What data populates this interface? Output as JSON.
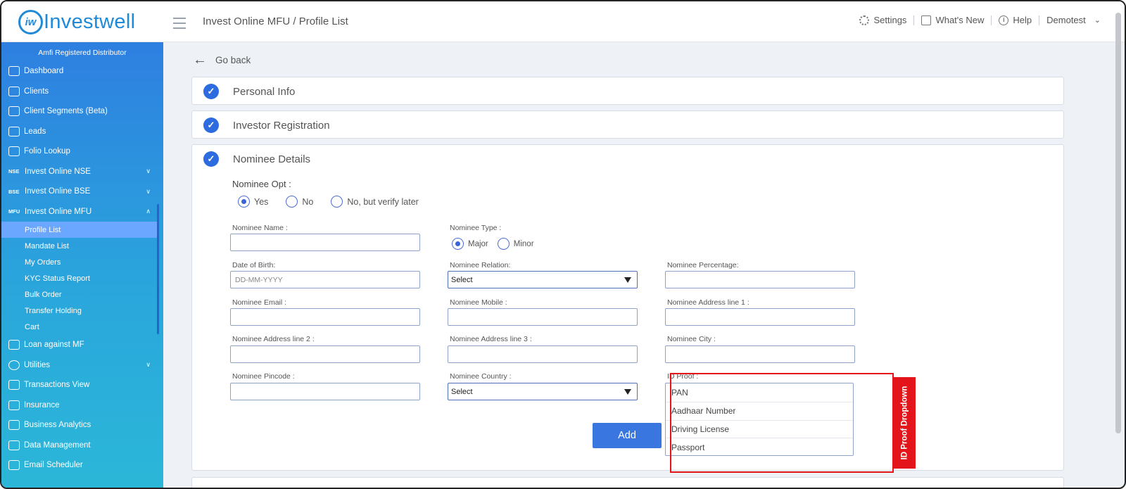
{
  "app": {
    "logo_mark": "iw",
    "logo_text": "Investwell",
    "breadcrumb": "Invest Online MFU / Profile List"
  },
  "topnav": {
    "settings": "Settings",
    "whats_new": "What's New",
    "help": "Help",
    "user": "Demotest"
  },
  "sidebar": {
    "title": "Amfi Registered Distributor",
    "items": [
      {
        "label": "Dashboard"
      },
      {
        "label": "Clients"
      },
      {
        "label": "Client Segments (Beta)"
      },
      {
        "label": "Leads"
      },
      {
        "label": "Folio Lookup"
      },
      {
        "tag": "NSE",
        "label": "Invest Online NSE",
        "caret": "v"
      },
      {
        "tag": "BSE",
        "label": "Invest Online BSE",
        "caret": "v"
      },
      {
        "tag": "MFU",
        "label": "Invest Online MFU",
        "caret": "^"
      }
    ],
    "sub_items": [
      "Profile List",
      "Mandate List",
      "My Orders",
      "KYC Status Report",
      "Bulk Order",
      "Transfer Holding",
      "Cart"
    ],
    "items_bottom": [
      {
        "label": "Loan against MF"
      },
      {
        "label": "Utilities",
        "caret": "v"
      },
      {
        "label": "Transactions View"
      },
      {
        "label": "Insurance"
      },
      {
        "label": "Business Analytics"
      },
      {
        "label": "Data Management"
      },
      {
        "label": "Email Scheduler"
      }
    ]
  },
  "main": {
    "go_back": "Go back",
    "sections": {
      "personal": "Personal Info",
      "registration": "Investor Registration",
      "nominee": "Nominee Details"
    },
    "nominee_opt": {
      "label": "Nominee Opt :",
      "options": [
        "Yes",
        "No",
        "No, but verify later"
      ],
      "selected": "Yes"
    },
    "nominee_type": {
      "label": "Nominee Type :",
      "options": [
        "Major",
        "Minor"
      ],
      "selected": "Major"
    },
    "fields": {
      "name": "Nominee Name :",
      "dob": "Date of Birth:",
      "dob_placeholder": "DD-MM-YYYY",
      "relation": "Nominee Relation:",
      "relation_value": "Select",
      "percentage": "Nominee Percentage:",
      "email": "Nominee Email :",
      "mobile": "Nominee Mobile :",
      "address1": "Nominee Address line 1 :",
      "address2": "Nominee Address line 2 :",
      "address3": "Nominee Address line 3 :",
      "city": "Nominee City :",
      "pincode": "Nominee Pincode :",
      "country": "Nominee Country :",
      "country_value": "Select",
      "id_proof": "ID Proof :"
    },
    "id_proof_options": [
      "PAN",
      "Aadhaar Number",
      "Driving License",
      "Passport"
    ],
    "add_button": "Add"
  },
  "annotation": {
    "label": "ID Proof Dropdown",
    "color": "#e3151a"
  }
}
